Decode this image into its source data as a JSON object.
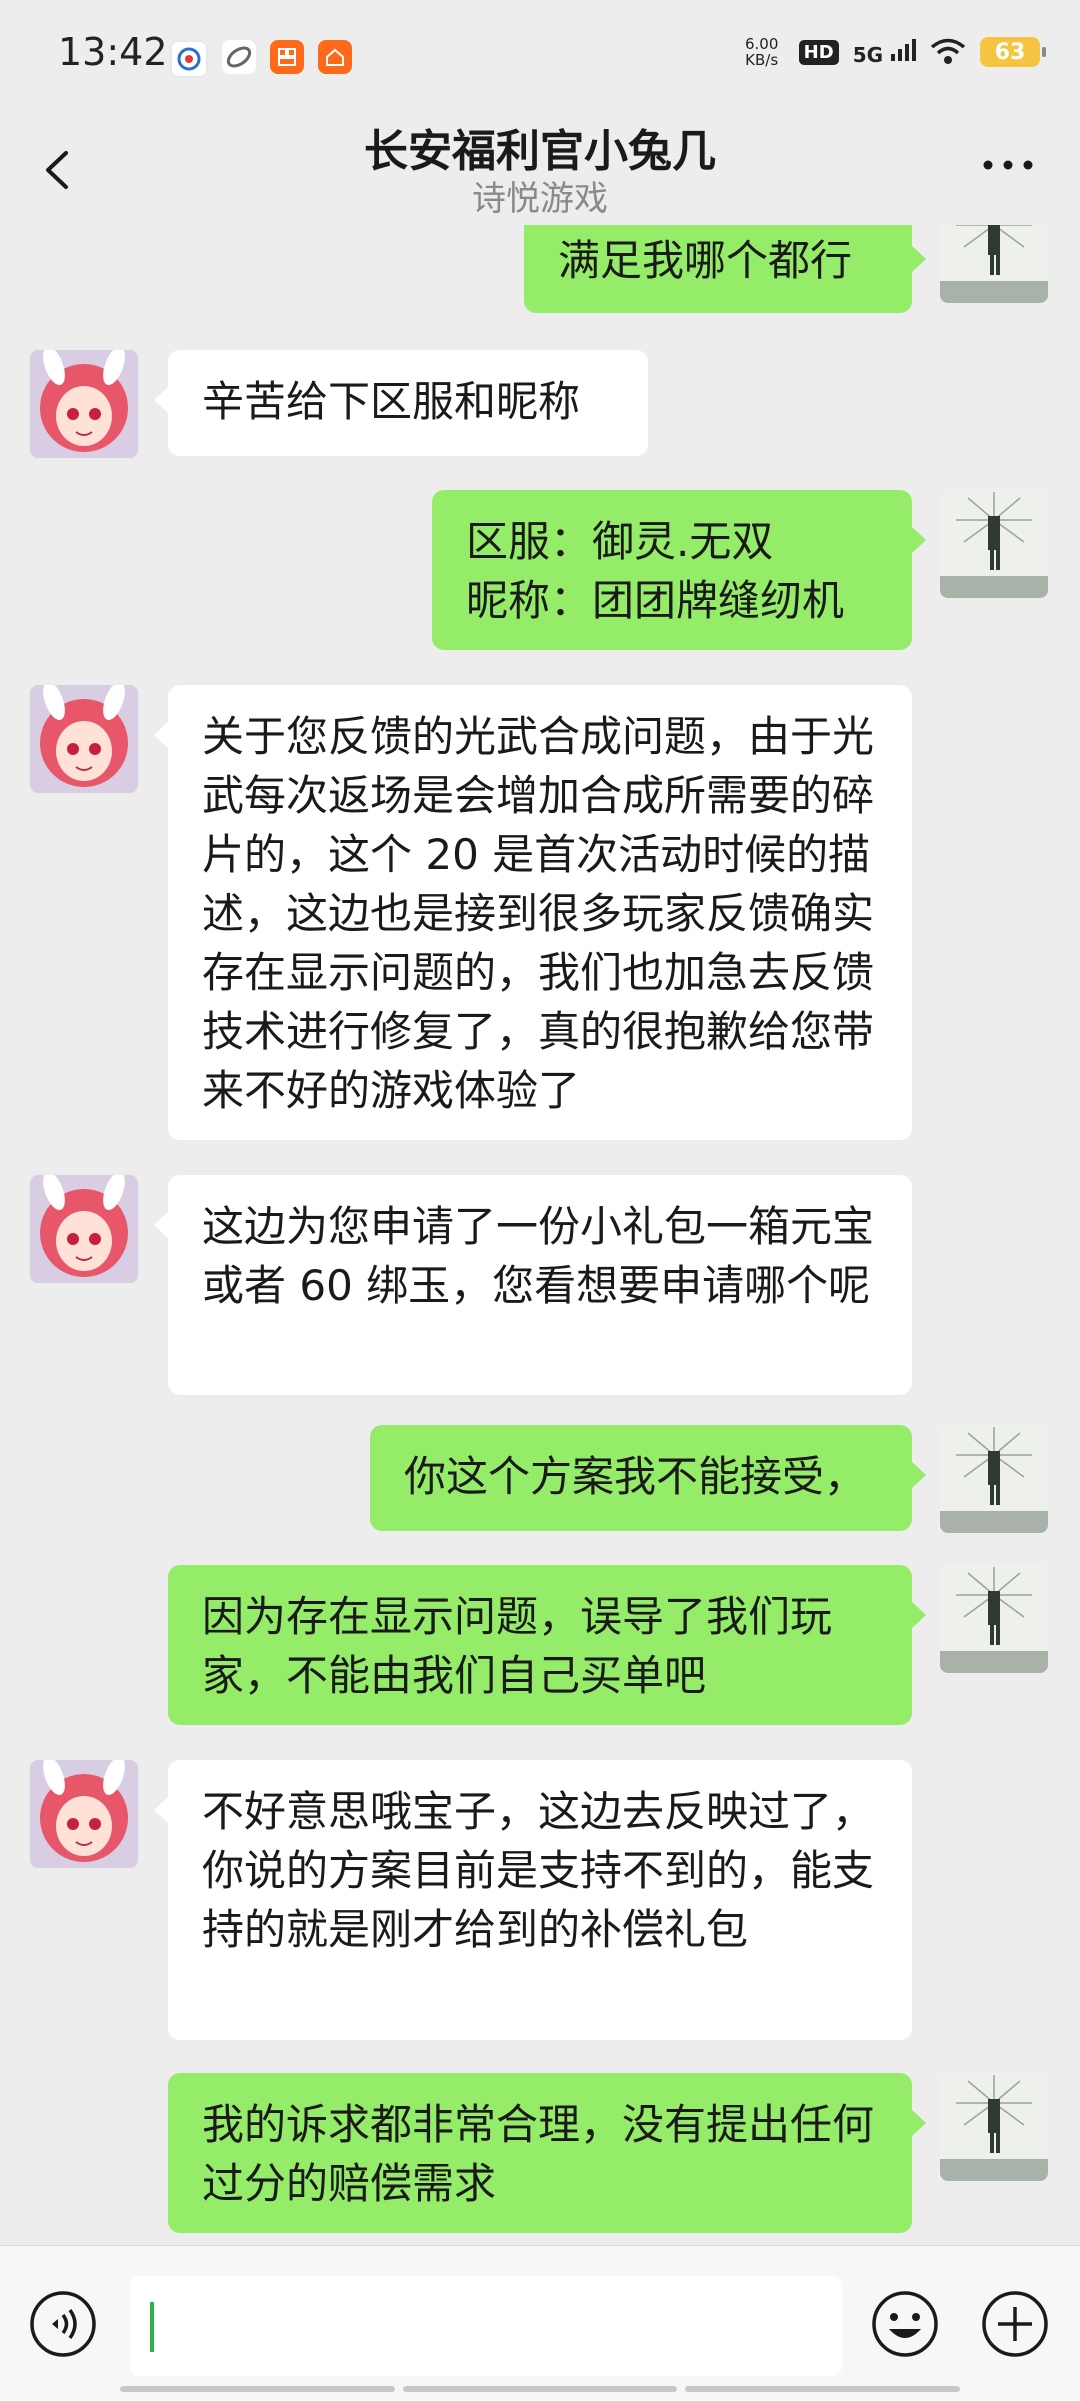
{
  "status_bar": {
    "time": "13:42",
    "speed_value": "6.00",
    "speed_unit": "KB/s",
    "hd": "HD",
    "network": "5G",
    "battery": "63"
  },
  "nav": {
    "title": "长安福利官小兔几",
    "subtitle": "诗悦游戏"
  },
  "messages": [
    {
      "side": "out",
      "text": "满足我哪个都行"
    },
    {
      "side": "in",
      "text": "辛苦给下区服和昵称"
    },
    {
      "side": "out",
      "text": "区服：御灵.无双\n昵称：团团牌缝纫机"
    },
    {
      "side": "in",
      "text": "关于您反馈的光武合成问题，由于光武每次返场是会增加合成所需要的碎片的，这个 20 是首次活动时候的描述，这边也是接到很多玩家反馈确实存在显示问题的，我们也加急去反馈技术进行修复了，真的很抱歉给您带来不好的游戏体验了"
    },
    {
      "side": "in",
      "text": "这边为您申请了一份小礼包一箱元宝或者 60 绑玉，您看想要申请哪个呢"
    },
    {
      "side": "out",
      "text": "你这个方案我不能接受，"
    },
    {
      "side": "out",
      "text": "因为存在显示问题，误导了我们玩家，不能由我们自己买单吧"
    },
    {
      "side": "in",
      "text": "不好意思哦宝子，这边去反映过了，你说的方案目前是支持不到的，能支持的就是刚才给到的补偿礼包"
    },
    {
      "side": "out",
      "text": "我的诉求都非常合理，没有提出任何过分的赔偿需求"
    }
  ],
  "input": {
    "value": ""
  },
  "icons": {
    "back": "back-arrow-icon",
    "more": "more-dots-icon",
    "voice": "voice-icon",
    "emoji": "emoji-icon",
    "plus": "plus-icon"
  },
  "colors": {
    "incoming_bubble": "#ffffff",
    "outgoing_bubble": "#95ec69",
    "background": "#ededed"
  }
}
